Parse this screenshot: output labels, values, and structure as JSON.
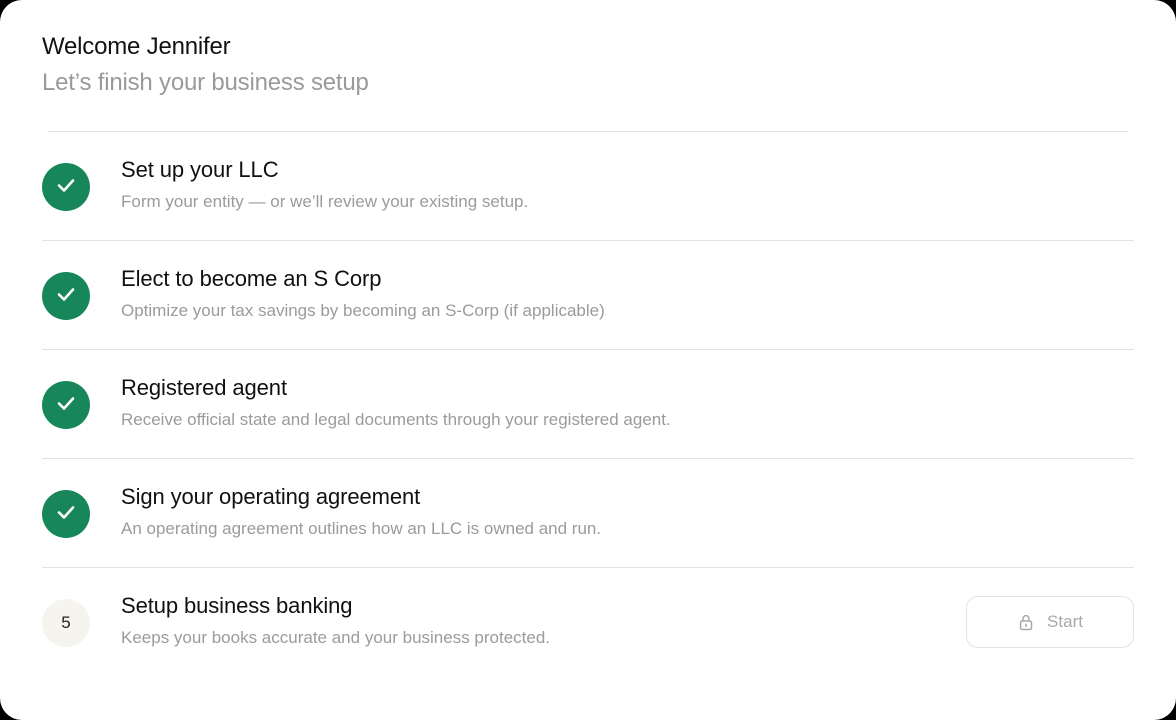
{
  "header": {
    "welcome": "Welcome Jennifer",
    "subtitle": "Let’s finish your business setup"
  },
  "steps": [
    {
      "status": "done",
      "icon": "check-icon",
      "title": "Set up your LLC",
      "description": "Form your entity — or we’ll review your existing setup."
    },
    {
      "status": "done",
      "icon": "check-icon",
      "title": "Elect to become an S Corp",
      "description": "Optimize your tax savings by becoming an S-Corp (if applicable)"
    },
    {
      "status": "done",
      "icon": "check-icon",
      "title": "Registered agent",
      "description": "Receive official state and legal documents through your registered agent."
    },
    {
      "status": "done",
      "icon": "check-icon",
      "title": "Sign your operating agreement",
      "description": "An operating agreement outlines how an LLC is owned and run."
    },
    {
      "status": "pending",
      "number": "5",
      "title": "Setup business banking",
      "description": "Keeps your books accurate and your business protected.",
      "action": {
        "label": "Start",
        "icon": "lock-icon",
        "disabled": true
      }
    }
  ],
  "colors": {
    "success": "#17875a",
    "pending_bg": "#f6f4ef",
    "muted_text": "#9b9b9b"
  }
}
